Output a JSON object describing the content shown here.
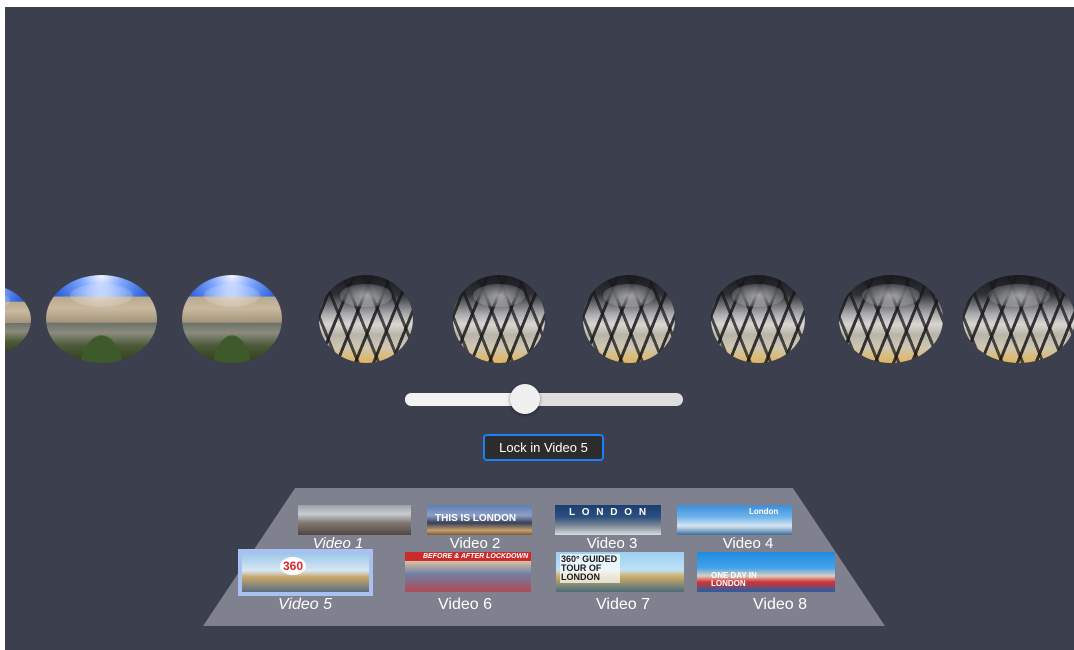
{
  "scene": {
    "spheres": [
      {
        "kind": "city",
        "icon": "panorama-sphere-video-5"
      },
      {
        "kind": "city",
        "icon": "panorama-sphere-video-5"
      },
      {
        "kind": "city",
        "icon": "panorama-sphere-video-5"
      },
      {
        "kind": "dome",
        "icon": "panorama-sphere-video-1"
      },
      {
        "kind": "dome",
        "icon": "panorama-sphere-video-1"
      },
      {
        "kind": "dome",
        "icon": "panorama-sphere-video-1"
      },
      {
        "kind": "dome",
        "icon": "panorama-sphere-video-1"
      },
      {
        "kind": "dome",
        "icon": "panorama-sphere-video-1"
      },
      {
        "kind": "dome",
        "icon": "panorama-sphere-video-1"
      }
    ],
    "background_color": "#3b3f4e"
  },
  "slider": {
    "value_fraction": 0.43
  },
  "lock_button": {
    "label": "Lock in Video 5",
    "accent_color": "#1d7ff5"
  },
  "video_grid": {
    "selected_index": 4,
    "videos": [
      {
        "label": "Video 1",
        "thumb_text": ""
      },
      {
        "label": "Video 2",
        "thumb_text": "THIS IS LONDON"
      },
      {
        "label": "Video 3",
        "thumb_text": "L O N D O N"
      },
      {
        "label": "Video 4",
        "thumb_text": "London"
      },
      {
        "label": "Video 5",
        "thumb_text": "360"
      },
      {
        "label": "Video 6",
        "thumb_text": "BEFORE & AFTER LOCKDOWN"
      },
      {
        "label": "Video 7",
        "thumb_text": "360° GUIDED TOUR OF LONDON"
      },
      {
        "label": "Video 8",
        "thumb_text": "ONE DAY IN LONDON"
      }
    ]
  }
}
